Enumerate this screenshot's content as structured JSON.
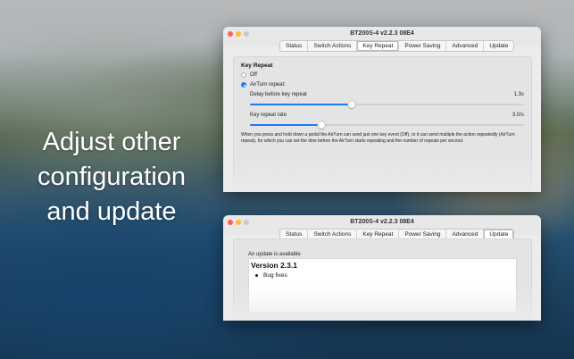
{
  "tagline": [
    "Adjust other",
    "configuration",
    "and update"
  ],
  "window_title": "BT200S-4 v2.2.3 08E4",
  "tabs": [
    "Status",
    "Switch Actions",
    "Key Repeat",
    "Power Saving",
    "Advanced",
    "Update"
  ],
  "top_window": {
    "active_tab": "Key Repeat",
    "section_heading": "Key Repeat",
    "options": [
      {
        "label": "Off",
        "selected": false
      },
      {
        "label": "AirTurn repeat:",
        "selected": true
      }
    ],
    "delay": {
      "label": "Delay before key repeat",
      "value": "1.3s",
      "level": 0.37
    },
    "rate": {
      "label": "Key repeat rate",
      "value": "3.0/s",
      "level": 0.26
    },
    "description": "When you press and hold down a pedal the AirTurn can send just one key event (Off),  or it can send multiple the action repeatedly (AirTurn repeat), for which you can set the time before the AirTurn starts repeating and the number of repeats per second."
  },
  "bottom_window": {
    "active_tab": "Update",
    "update_label": "An update is available",
    "version_title": "Version 2.3.1",
    "notes": [
      "Bug fixes"
    ]
  },
  "colors": {
    "accent": "#1b7cf4",
    "window_bg": "#ececec",
    "close": "#fe5f57",
    "minimize": "#febc2e"
  }
}
